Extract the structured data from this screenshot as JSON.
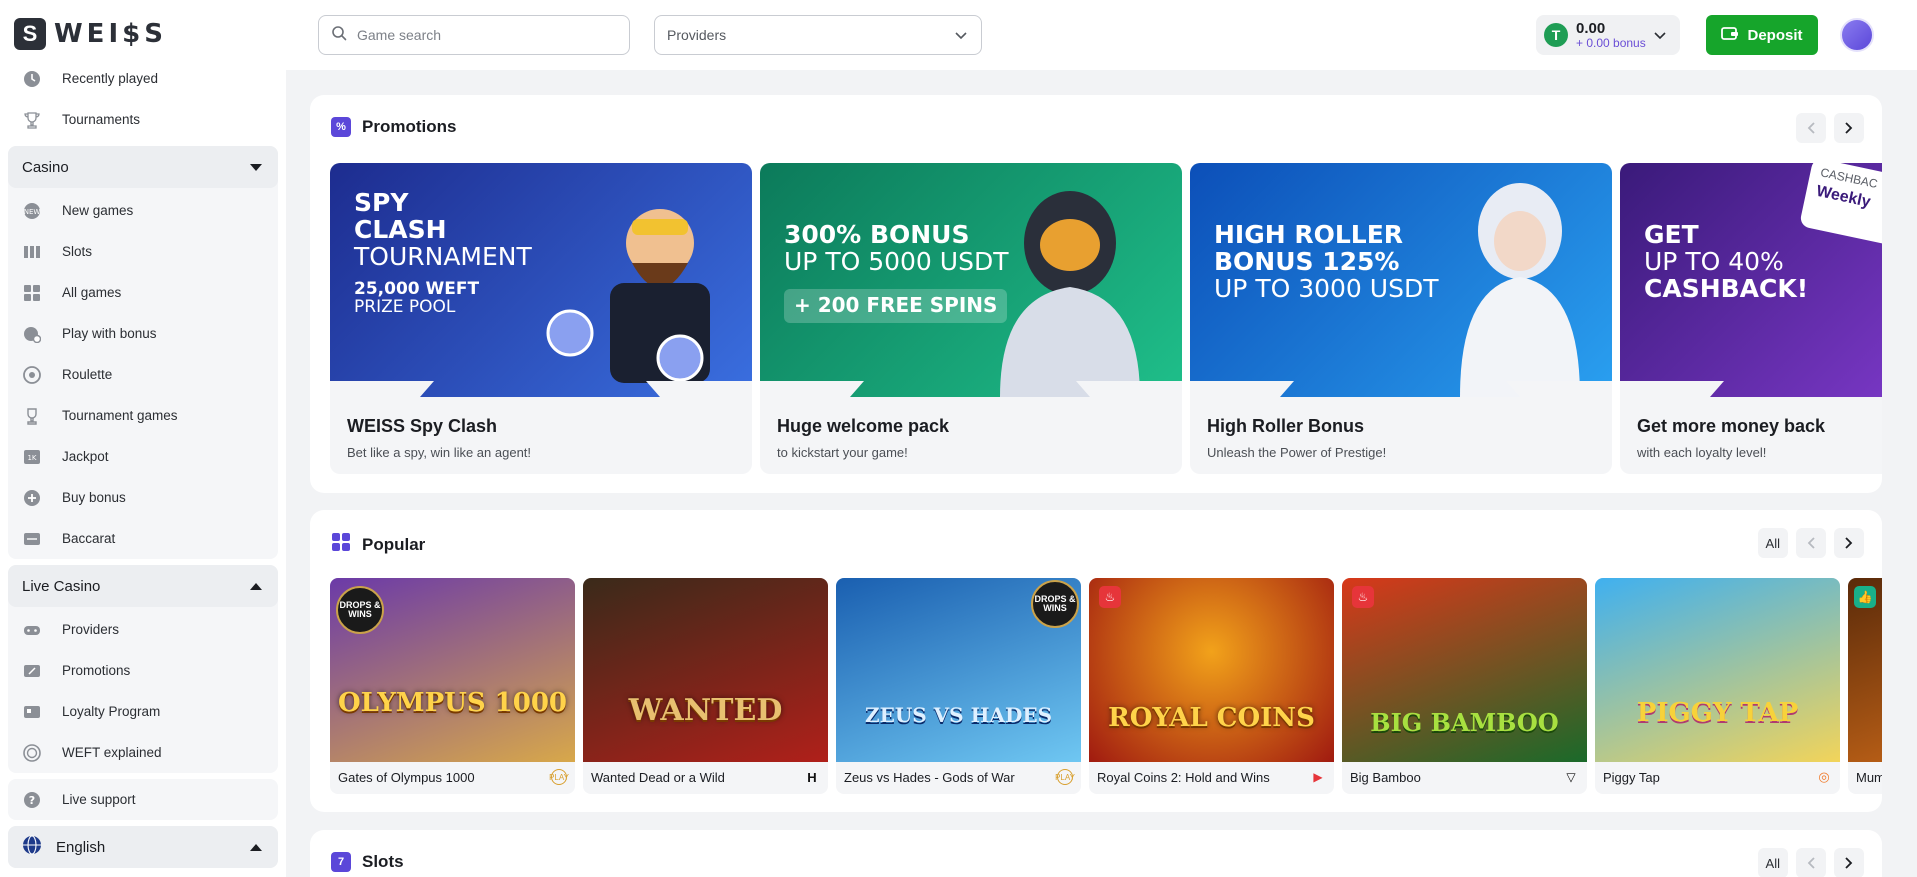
{
  "header": {
    "logo_letter": "S",
    "logo_text": "WEI$S",
    "search_placeholder": "Game search",
    "providers_label": "Providers",
    "balance": {
      "coin": "T",
      "amount": "0.00",
      "bonus": "+ 0.00 bonus"
    },
    "deposit_label": "Deposit"
  },
  "sidebar": {
    "top_items": [
      {
        "label": "Recently played",
        "icon": "clock-icon"
      },
      {
        "label": "Tournaments",
        "icon": "trophy-icon"
      }
    ],
    "casino": {
      "title": "Casino",
      "items": [
        {
          "label": "New games",
          "icon": "new-badge-icon"
        },
        {
          "label": "Slots",
          "icon": "slots-icon"
        },
        {
          "label": "All games",
          "icon": "grid-icon"
        },
        {
          "label": "Play with bonus",
          "icon": "bonus-icon"
        },
        {
          "label": "Roulette",
          "icon": "roulette-icon"
        },
        {
          "label": "Tournament games",
          "icon": "trophy-icon"
        },
        {
          "label": "Jackpot",
          "icon": "jackpot-icon"
        },
        {
          "label": "Buy bonus",
          "icon": "plus-circle-icon"
        },
        {
          "label": "Baccarat",
          "icon": "cards-icon"
        }
      ]
    },
    "live_casino": {
      "title": "Live Casino",
      "items": [
        {
          "label": "Providers",
          "icon": "gamepad-icon"
        },
        {
          "label": "Promotions",
          "icon": "ticket-icon"
        },
        {
          "label": "Loyalty Program",
          "icon": "loyalty-icon"
        },
        {
          "label": "WEFT explained",
          "icon": "coin-icon"
        }
      ]
    },
    "support": {
      "label": "Live support",
      "icon": "question-icon"
    },
    "language": {
      "label": "English",
      "icon": "globe-icon"
    }
  },
  "promotions": {
    "title": "Promotions",
    "cards": [
      {
        "lines": [
          "SPY",
          "CLASH",
          "TOURNAMENT",
          "25,000 WEFT",
          "PRIZE POOL"
        ],
        "title": "WEISS Spy Clash",
        "subtitle": "Bet like a spy, win like an agent!",
        "colors": [
          "#1d2c8f",
          "#3a6fe0"
        ]
      },
      {
        "lines": [
          "300% BONUS",
          "UP TO 5000 USDT",
          "+ 200 FREE SPINS"
        ],
        "title": "Huge welcome pack",
        "subtitle": "to kickstart your game!",
        "colors": [
          "#0c7a5a",
          "#1fbf8a"
        ]
      },
      {
        "lines": [
          "HIGH ROLLER",
          "BONUS 125%",
          "UP TO 3000 USDT"
        ],
        "title": "High Roller Bonus",
        "subtitle": "Unleash the Power of Prestige!",
        "colors": [
          "#0c4fb8",
          "#2aa0f0"
        ]
      },
      {
        "lines": [
          "GET",
          "UP TO 40%",
          "CASHBACK!"
        ],
        "badge": "Weekly",
        "tag": "CASHBAC",
        "title": "Get more money back",
        "subtitle": "with each loyalty level!",
        "colors": [
          "#3a1a7a",
          "#8a3fd9"
        ]
      }
    ]
  },
  "popular": {
    "title": "Popular",
    "all_label": "All",
    "games": [
      {
        "name": "Gates of Olympus 1000",
        "logo": "OLYMPUS 1000",
        "drops": "DROPS & WINS",
        "drops_side": "left",
        "provider_icon": "PLAY",
        "colors": [
          "#6b3aa8",
          "#d8a84a"
        ]
      },
      {
        "name": "Wanted Dead or a Wild",
        "logo": "WANTED",
        "provider_icon": "H",
        "colors": [
          "#3a2a1a",
          "#b0201a"
        ]
      },
      {
        "name": "Zeus vs Hades - Gods of War",
        "logo": "ZEUS VS HADES",
        "drops": "DROPS & WINS",
        "drops_side": "right",
        "provider_icon": "PLAY",
        "colors": [
          "#1a5fb0",
          "#6fc7f2"
        ]
      },
      {
        "name": "Royal Coins 2: Hold and Wins",
        "logo": "ROYAL COINS",
        "hot": true,
        "provider_icon": "▶",
        "colors": [
          "#a01a10",
          "#f2a21a"
        ]
      },
      {
        "name": "Big Bamboo",
        "logo": "BIG BAMBOO",
        "hot": true,
        "provider_icon": "▽",
        "colors": [
          "#1a6a2a",
          "#d8381a"
        ]
      },
      {
        "name": "Piggy Tap",
        "logo": "PIGGY TAP",
        "provider_icon": "◎",
        "colors": [
          "#3fb0f0",
          "#f2d45a"
        ]
      },
      {
        "name": "Mum",
        "logo": "",
        "like": true,
        "provider_icon": "",
        "colors": [
          "#5a2a0a",
          "#d8701a"
        ]
      }
    ]
  },
  "slots": {
    "title": "Slots",
    "all_label": "All"
  }
}
